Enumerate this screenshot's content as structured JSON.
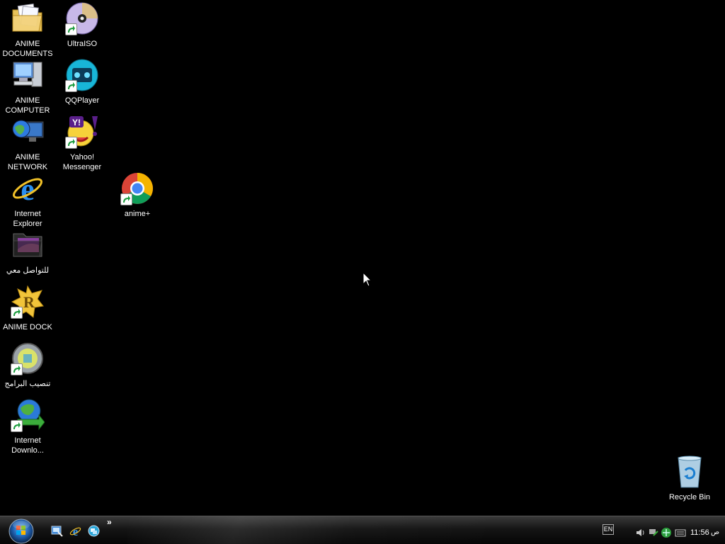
{
  "desktop": {
    "icons": [
      {
        "label": "ANIME DOCUMENTS",
        "icon": "folder-documents-icon"
      },
      {
        "label": "ANIME COMPUTER",
        "icon": "computer-icon"
      },
      {
        "label": "ANIME NETWORK",
        "icon": "network-globe-icon"
      },
      {
        "label": "Internet Explorer",
        "icon": "internet-explorer-icon"
      },
      {
        "label": "للتواصل معي",
        "icon": "dark-folder-icon"
      },
      {
        "label": "ANIME DOCK",
        "icon": "rocketdock-icon"
      },
      {
        "label": "تنصيب البرامج",
        "icon": "install-programs-icon"
      },
      {
        "label": "Internet Downlo...",
        "icon": "internet-download-manager-icon"
      },
      {
        "label": "UltraISO",
        "icon": "ultraiso-disc-icon"
      },
      {
        "label": "QQPlayer",
        "icon": "qqplayer-icon"
      },
      {
        "label": "Yahoo! Messenger",
        "icon": "yahoo-messenger-icon"
      },
      {
        "label": "anime+",
        "icon": "chrome-icon"
      },
      {
        "label": "Recycle Bin",
        "icon": "recycle-bin-icon"
      }
    ]
  },
  "taskbar": {
    "start": "start-orb-icon",
    "quick_launch": [
      "show-desktop-icon",
      "internet-explorer-icon",
      "switch-windows-icon"
    ],
    "chevron": "»",
    "language": "EN",
    "tray_icons": [
      "volume-icon",
      "network-icon",
      "security-icon",
      "keyboard-icon"
    ],
    "clock": "11:56",
    "ampm": "ص"
  },
  "colors": {
    "desktop_bg": "#000000",
    "taskbar_bg": "#151515",
    "label_text": "#ffffff"
  }
}
